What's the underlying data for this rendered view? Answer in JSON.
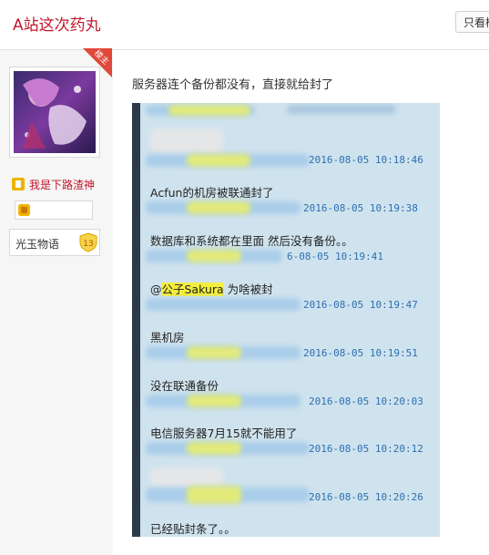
{
  "header": {
    "title": "A站这次药丸",
    "only_op_label": "只看楼"
  },
  "user": {
    "op_badge": "楼主",
    "username": "我是下路渣神",
    "badge_name": "光玉物语",
    "badge_level": "13"
  },
  "post": {
    "text": "服务器连个备份都没有，直接就给封了",
    "chat": [
      {
        "message": "",
        "timestamp": "2016-08-05 10:18:46"
      },
      {
        "message": "Acfun的机房被联通封了",
        "timestamp": "2016-08-05 10:19:38"
      },
      {
        "message": "数据库和系统都在里面 然后没有备份。。",
        "timestamp": "6-08-05 10:19:41"
      },
      {
        "message_prefix": "@",
        "mention": "公子Sakura",
        "message_suffix": " 为啥被封",
        "timestamp": "2016-08-05 10:19:47"
      },
      {
        "message": "黑机房",
        "timestamp": "2016-08-05 10:19:51"
      },
      {
        "message": "没在联通备份",
        "timestamp": "2016-08-05 10:20:03"
      },
      {
        "message": "电信服务器7月15就不能用了",
        "timestamp": "2016-08-05 10:20:12"
      },
      {
        "message": "",
        "timestamp": "2016-08-05 10:20:26"
      },
      {
        "message": "已经贴封条了。。",
        "timestamp": ""
      }
    ]
  },
  "colors": {
    "title_red": "#c3162b",
    "timestamp_blue": "#2e6fb0",
    "mention_yellow": "#f4ef3c",
    "chat_bg": "#cfe3ee"
  }
}
